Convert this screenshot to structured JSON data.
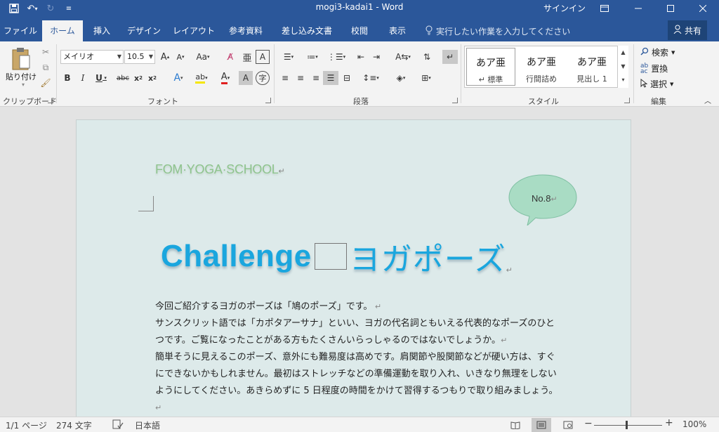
{
  "titlebar": {
    "title": "mogi3-kadai1  -  Word",
    "signin": "サインイン"
  },
  "tabs": [
    {
      "label": "ファイル"
    },
    {
      "label": "ホーム"
    },
    {
      "label": "挿入"
    },
    {
      "label": "デザイン"
    },
    {
      "label": "レイアウト"
    },
    {
      "label": "参考資料"
    },
    {
      "label": "差し込み文書"
    },
    {
      "label": "校閲"
    },
    {
      "label": "表示"
    }
  ],
  "tellme": "実行したい作業を入力してください",
  "share": "共有",
  "ribbon": {
    "clipboard": {
      "paste": "貼り付け",
      "group": "クリップボード"
    },
    "font": {
      "name": "メイリオ",
      "size": "10.5",
      "group": "フォント"
    },
    "paragraph": {
      "group": "段落"
    },
    "styles": {
      "group": "スタイル",
      "items": [
        {
          "sample": "あア亜",
          "name": "↵ 標準"
        },
        {
          "sample": "あア亜",
          "name": "行間詰め"
        },
        {
          "sample": "あア亜",
          "name": "見出し 1"
        }
      ]
    },
    "editing": {
      "find": "検索",
      "replace": "置換",
      "select": "選択",
      "group": "編集"
    }
  },
  "document": {
    "brand": "FOM·YOGA·SCHOOL",
    "bubble": "No.8",
    "headline_en": "Challenge",
    "headline_jp": "ヨガポーズ",
    "paragraphs": [
      "今回ご紹介するヨガのポーズは「鳩のポーズ」です。",
      "サンスクリット語では「カポタアーサナ」といい、ヨガの代名詞ともいえる代表的なポーズのひとつです。ご覧になったことがある方もたくさんいらっしゃるのではないでしょうか。",
      "簡単そうに見えるこのポーズ、意外にも難易度は高めです。肩関節や股関節などが硬い方は、すぐにできないかもしれません。最初はストレッチなどの準備運動を取り入れ、いきなり無理をしないようにしてください。あきらめずに 5 日程度の時間をかけて習得するつもりで取り組みましょう。"
    ]
  },
  "status": {
    "page": "1/1 ページ",
    "words": "274 文字",
    "lang": "日本語",
    "zoom": "100%"
  },
  "colors": {
    "brand_blue": "#2b579a",
    "headline": "#1aa6de",
    "page_bg": "#ddeaea",
    "bubble_fill": "#a9dcc4"
  }
}
